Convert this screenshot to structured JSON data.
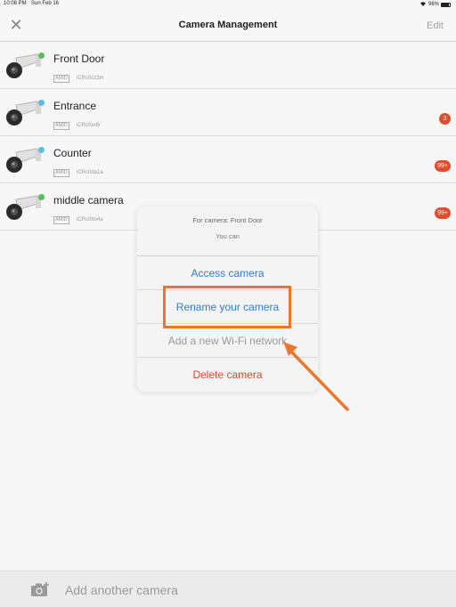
{
  "status_bar": {
    "time": "10:08 PM",
    "date": "Sun Feb 16",
    "battery": "96%"
  },
  "nav": {
    "title": "Camera Management",
    "edit_label": "Edit",
    "close_icon": "close-icon"
  },
  "cameras": [
    {
      "name": "Front Door",
      "tag": "AMID",
      "id": "iCRc0cz3m",
      "status_color": "#5cc75c",
      "badge": ""
    },
    {
      "name": "Entrance",
      "tag": "AMID",
      "id": "iCRc0er6r",
      "status_color": "#5fc4e8",
      "badge": "3"
    },
    {
      "name": "Counter",
      "tag": "AMID",
      "id": "iCRc0da1a",
      "status_color": "#5fc4e8",
      "badge": "99+"
    },
    {
      "name": "middle camera",
      "tag": "AMID",
      "id": "iCRc0bo4a",
      "status_color": "#5cc75c",
      "badge": "99+"
    }
  ],
  "action_sheet": {
    "title": "For camera: Front Door",
    "subtitle": "You can",
    "options": [
      {
        "label": "Access camera",
        "color": "blue"
      },
      {
        "label": "Rename your camera",
        "color": "blue"
      },
      {
        "label": "Add a new Wi-Fi network",
        "color": "gray"
      },
      {
        "label": "Delete camera",
        "color": "red"
      }
    ]
  },
  "footer": {
    "add_label": "Add another camera"
  },
  "colors": {
    "accent_blue": "#2f7bd4",
    "destructive_red": "#e5432b",
    "badge_red": "#e8502e",
    "highlight_orange": "#e9772d"
  }
}
